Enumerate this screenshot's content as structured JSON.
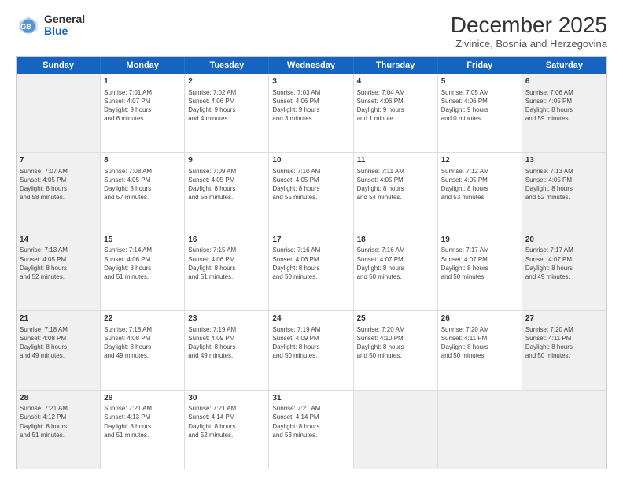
{
  "logo": {
    "line1": "General",
    "line2": "Blue"
  },
  "title": "December 2025",
  "subtitle": "Zivinice, Bosnia and Herzegovina",
  "header_days": [
    "Sunday",
    "Monday",
    "Tuesday",
    "Wednesday",
    "Thursday",
    "Friday",
    "Saturday"
  ],
  "weeks": [
    [
      {
        "day": "",
        "content": "",
        "shaded": true
      },
      {
        "day": "1",
        "content": "Sunrise: 7:01 AM\nSunset: 4:07 PM\nDaylight: 9 hours\nand 6 minutes."
      },
      {
        "day": "2",
        "content": "Sunrise: 7:02 AM\nSunset: 4:06 PM\nDaylight: 9 hours\nand 4 minutes."
      },
      {
        "day": "3",
        "content": "Sunrise: 7:03 AM\nSunset: 4:06 PM\nDaylight: 9 hours\nand 3 minutes."
      },
      {
        "day": "4",
        "content": "Sunrise: 7:04 AM\nSunset: 4:06 PM\nDaylight: 9 hours\nand 1 minute."
      },
      {
        "day": "5",
        "content": "Sunrise: 7:05 AM\nSunset: 4:06 PM\nDaylight: 9 hours\nand 0 minutes."
      },
      {
        "day": "6",
        "content": "Sunrise: 7:06 AM\nSunset: 4:05 PM\nDaylight: 8 hours\nand 59 minutes.",
        "shaded": true
      }
    ],
    [
      {
        "day": "7",
        "content": "Sunrise: 7:07 AM\nSunset: 4:05 PM\nDaylight: 8 hours\nand 58 minutes.",
        "shaded": true
      },
      {
        "day": "8",
        "content": "Sunrise: 7:08 AM\nSunset: 4:05 PM\nDaylight: 8 hours\nand 57 minutes."
      },
      {
        "day": "9",
        "content": "Sunrise: 7:09 AM\nSunset: 4:05 PM\nDaylight: 8 hours\nand 56 minutes."
      },
      {
        "day": "10",
        "content": "Sunrise: 7:10 AM\nSunset: 4:05 PM\nDaylight: 8 hours\nand 55 minutes."
      },
      {
        "day": "11",
        "content": "Sunrise: 7:11 AM\nSunset: 4:05 PM\nDaylight: 8 hours\nand 54 minutes."
      },
      {
        "day": "12",
        "content": "Sunrise: 7:12 AM\nSunset: 4:05 PM\nDaylight: 8 hours\nand 53 minutes."
      },
      {
        "day": "13",
        "content": "Sunrise: 7:13 AM\nSunset: 4:05 PM\nDaylight: 8 hours\nand 52 minutes.",
        "shaded": true
      }
    ],
    [
      {
        "day": "14",
        "content": "Sunrise: 7:13 AM\nSunset: 4:05 PM\nDaylight: 8 hours\nand 52 minutes.",
        "shaded": true
      },
      {
        "day": "15",
        "content": "Sunrise: 7:14 AM\nSunset: 4:06 PM\nDaylight: 8 hours\nand 51 minutes."
      },
      {
        "day": "16",
        "content": "Sunrise: 7:15 AM\nSunset: 4:06 PM\nDaylight: 8 hours\nand 51 minutes."
      },
      {
        "day": "17",
        "content": "Sunrise: 7:16 AM\nSunset: 4:06 PM\nDaylight: 8 hours\nand 50 minutes."
      },
      {
        "day": "18",
        "content": "Sunrise: 7:16 AM\nSunset: 4:07 PM\nDaylight: 8 hours\nand 50 minutes."
      },
      {
        "day": "19",
        "content": "Sunrise: 7:17 AM\nSunset: 4:07 PM\nDaylight: 8 hours\nand 50 minutes."
      },
      {
        "day": "20",
        "content": "Sunrise: 7:17 AM\nSunset: 4:07 PM\nDaylight: 8 hours\nand 49 minutes.",
        "shaded": true
      }
    ],
    [
      {
        "day": "21",
        "content": "Sunrise: 7:18 AM\nSunset: 4:08 PM\nDaylight: 8 hours\nand 49 minutes.",
        "shaded": true
      },
      {
        "day": "22",
        "content": "Sunrise: 7:18 AM\nSunset: 4:08 PM\nDaylight: 8 hours\nand 49 minutes."
      },
      {
        "day": "23",
        "content": "Sunrise: 7:19 AM\nSunset: 4:09 PM\nDaylight: 8 hours\nand 49 minutes."
      },
      {
        "day": "24",
        "content": "Sunrise: 7:19 AM\nSunset: 4:09 PM\nDaylight: 8 hours\nand 50 minutes."
      },
      {
        "day": "25",
        "content": "Sunrise: 7:20 AM\nSunset: 4:10 PM\nDaylight: 8 hours\nand 50 minutes."
      },
      {
        "day": "26",
        "content": "Sunrise: 7:20 AM\nSunset: 4:11 PM\nDaylight: 8 hours\nand 50 minutes."
      },
      {
        "day": "27",
        "content": "Sunrise: 7:20 AM\nSunset: 4:11 PM\nDaylight: 8 hours\nand 50 minutes.",
        "shaded": true
      }
    ],
    [
      {
        "day": "28",
        "content": "Sunrise: 7:21 AM\nSunset: 4:12 PM\nDaylight: 8 hours\nand 51 minutes.",
        "shaded": true
      },
      {
        "day": "29",
        "content": "Sunrise: 7:21 AM\nSunset: 4:13 PM\nDaylight: 8 hours\nand 51 minutes."
      },
      {
        "day": "30",
        "content": "Sunrise: 7:21 AM\nSunset: 4:14 PM\nDaylight: 8 hours\nand 52 minutes."
      },
      {
        "day": "31",
        "content": "Sunrise: 7:21 AM\nSunset: 4:14 PM\nDaylight: 8 hours\nand 53 minutes."
      },
      {
        "day": "",
        "content": "",
        "shaded": true
      },
      {
        "day": "",
        "content": "",
        "shaded": true
      },
      {
        "day": "",
        "content": "",
        "shaded": true
      }
    ]
  ]
}
